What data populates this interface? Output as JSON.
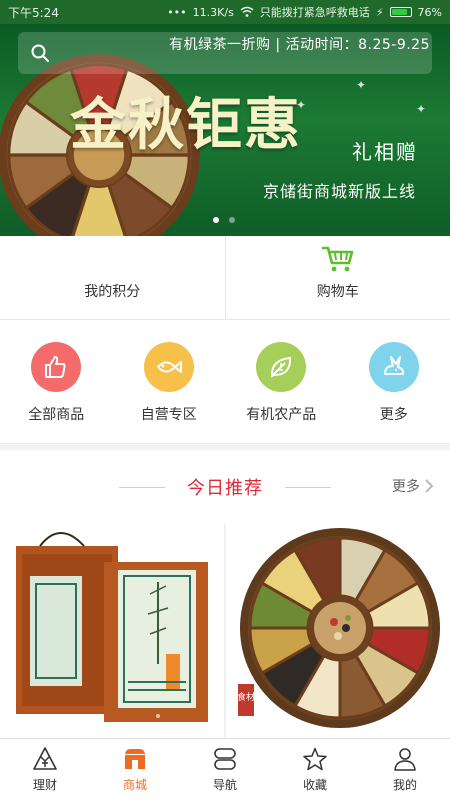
{
  "status_bar": {
    "time": "下午5:24",
    "network_speed": "11.3K/s",
    "carrier_text": "只能拨打紧急呼救电话",
    "battery": "76%"
  },
  "banner": {
    "promo": "有机绿茶一折购 | 活动时间：8.25-9.25",
    "title": "金秋钜惠",
    "gift_text": "礼相赠",
    "subtitle": "京储街商城新版上线",
    "search_icon": "search-icon",
    "page_count": 2,
    "active_page": 1
  },
  "quick_links": {
    "points_label": "我的积分",
    "cart_label": "购物车",
    "cart_icon": "cart-icon"
  },
  "categories": [
    {
      "label": "全部商品",
      "icon": "thumbs-up-icon",
      "color": "#f46b6b"
    },
    {
      "label": "自营专区",
      "icon": "fish-icon",
      "color": "#f6c04a"
    },
    {
      "label": "有机农产品",
      "icon": "leaf-icon",
      "color": "#a6cf5a"
    },
    {
      "label": "更多",
      "icon": "rabbit-icon",
      "color": "#7fd3ea"
    }
  ],
  "recommend": {
    "heading": "今日推荐",
    "more_label": "更多",
    "seal_text": "食材"
  },
  "tabbar": {
    "items": [
      {
        "label": "理财",
        "icon": "yuan-icon"
      },
      {
        "label": "商城",
        "icon": "shop-icon"
      },
      {
        "label": "导航",
        "icon": "navigation-icon"
      },
      {
        "label": "收藏",
        "icon": "star-icon"
      },
      {
        "label": "我的",
        "icon": "user-icon"
      }
    ],
    "active_index": 1
  },
  "colors": {
    "accent": "#ef6b23",
    "heading_red": "#e0283b",
    "cart_green": "#5bbf2a",
    "banner_green": "#1c7a33"
  }
}
